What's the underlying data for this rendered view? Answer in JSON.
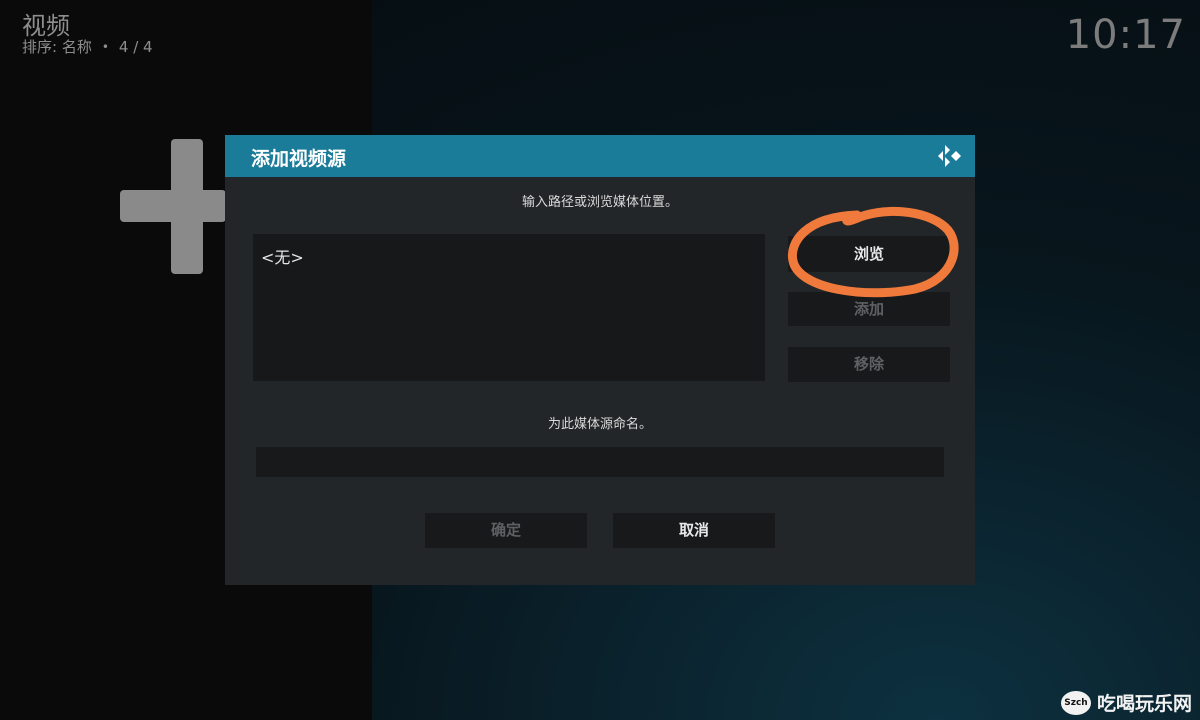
{
  "header": {
    "title": "视频",
    "sort_label": "排序: 名称",
    "dot": "•",
    "count": "4 / 4",
    "clock": "10:17"
  },
  "dialog": {
    "title": "添加视频源",
    "path_prompt": "输入路径或浏览媒体位置。",
    "paths": [
      "<无>"
    ],
    "browse_label": "浏览",
    "add_label": "添加",
    "remove_label": "移除",
    "name_prompt": "为此媒体源命名。",
    "name_value": "",
    "ok_label": "确定",
    "cancel_label": "取消"
  },
  "watermark": {
    "seal": "Szch",
    "text": "吃喝玩乐网"
  },
  "colors": {
    "dialog_header": "#1b7c9a",
    "annotation_ring": "#f07a3c"
  }
}
